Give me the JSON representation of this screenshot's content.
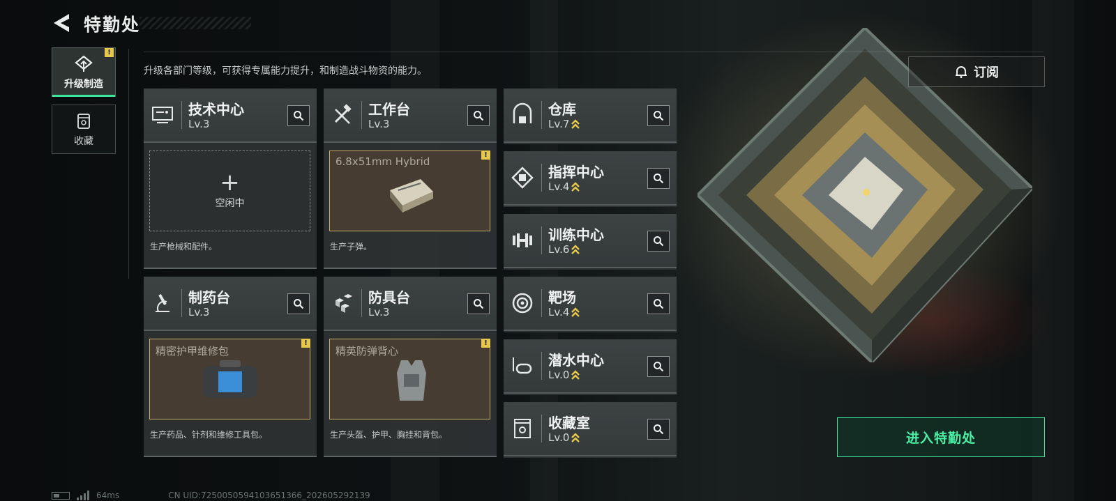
{
  "header": {
    "title": "特勤处",
    "description": "升级各部门等级，可获得专属能力提升，和制造战斗物资的能力。"
  },
  "sidebar": {
    "items": [
      {
        "label": "升级制造",
        "active": true,
        "icon": "upgrade-build-icon",
        "alert": "!"
      },
      {
        "label": "收藏",
        "active": false,
        "icon": "collection-icon"
      }
    ]
  },
  "subscribe": {
    "label": "订阅",
    "icon": "bell-icon"
  },
  "enter_button": {
    "label": "进入特勤处"
  },
  "production_cards": [
    {
      "name": "技术中心",
      "level": "Lv.3",
      "icon": "monitor-icon",
      "slot": {
        "state": "empty",
        "plus": "+",
        "text": "空闲中"
      },
      "note": "生产枪械和配件。"
    },
    {
      "name": "工作台",
      "level": "Lv.3",
      "icon": "tools-icon",
      "slot": {
        "state": "item",
        "item_name": "6.8x51mm Hybrid",
        "alert": "!",
        "item_icon": "ammo-box-icon"
      },
      "note": "生产子弹。"
    },
    {
      "name": "制药台",
      "level": "Lv.3",
      "icon": "microscope-icon",
      "slot": {
        "state": "item",
        "item_name": "精密护甲维修包",
        "alert": "!",
        "item_icon": "repair-kit-icon"
      },
      "note": "生产药品、针剂和维修工具包。"
    },
    {
      "name": "防具台",
      "level": "Lv.3",
      "icon": "cubes-icon",
      "slot": {
        "state": "item",
        "item_name": "精英防弹背心",
        "alert": "!",
        "item_icon": "armor-vest-icon"
      },
      "note": "生产头盔、护甲、胸挂和背包。"
    }
  ],
  "facilities": [
    {
      "name": "仓库",
      "level": "Lv.7",
      "icon": "warehouse-icon",
      "upgradable": true
    },
    {
      "name": "指挥中心",
      "level": "Lv.4",
      "icon": "chip-icon",
      "upgradable": true
    },
    {
      "name": "训练中心",
      "level": "Lv.6",
      "icon": "dumbbell-icon",
      "upgradable": true
    },
    {
      "name": "靶场",
      "level": "Lv.4",
      "icon": "target-icon",
      "upgradable": true
    },
    {
      "name": "潜水中心",
      "level": "Lv.0",
      "icon": "diving-mask-icon",
      "upgradable": true
    },
    {
      "name": "收藏室",
      "level": "Lv.0",
      "icon": "trophy-case-icon",
      "upgradable": true
    }
  ],
  "footer": {
    "ping": "64ms",
    "uid": "CN UID:7250050594103651366_202605292139"
  },
  "colors": {
    "accent_green": "#3ce59a",
    "alert_yellow": "#e6c84a",
    "card_bg": "#3d4243",
    "item_slot_bg": "#463c32"
  }
}
